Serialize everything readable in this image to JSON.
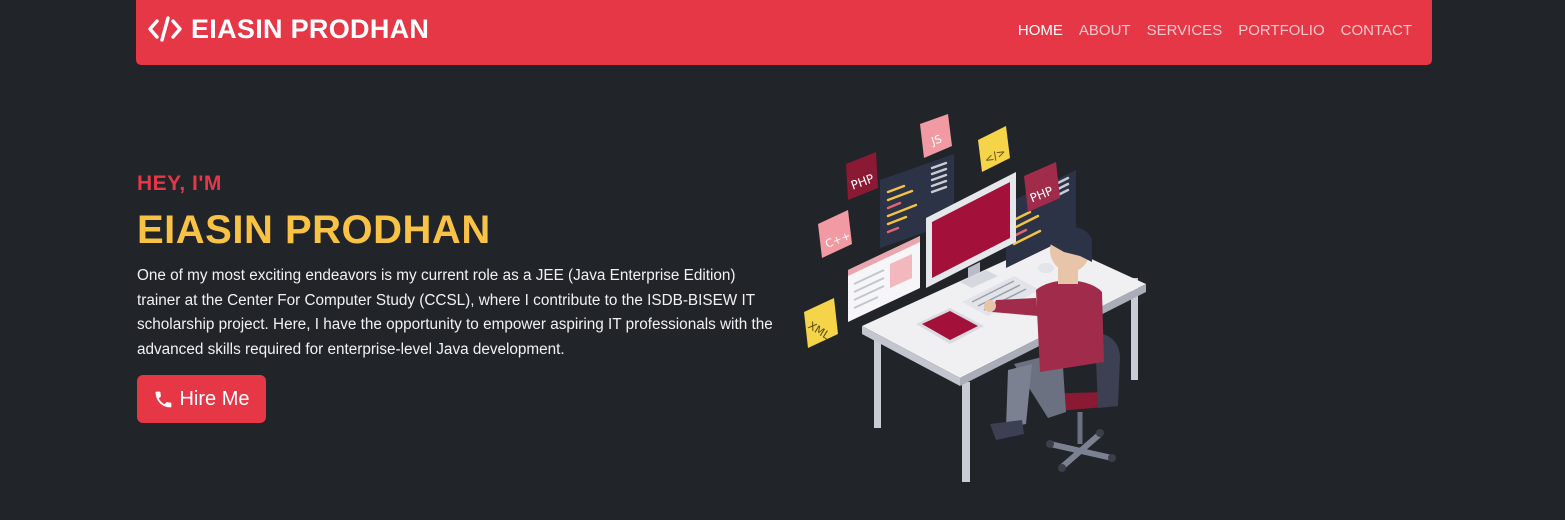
{
  "navbar": {
    "brand_icon": "code-icon",
    "brand": "EIASIN PRODHAN",
    "links": [
      {
        "label": "HOME",
        "active": true
      },
      {
        "label": "ABOUT",
        "active": false
      },
      {
        "label": "SERVICES",
        "active": false
      },
      {
        "label": "PORTFOLIO",
        "active": false
      },
      {
        "label": "CONTACT",
        "active": false
      }
    ]
  },
  "hero": {
    "greeting": "HEY, I'M",
    "name": "EIASIN PRODHAN",
    "description": "One of my most exciting endeavors is my current role as a JEE (Java Enterprise Edition) trainer at the Center For Computer Study (CCSL), where I contribute to the ISDB-BISEW IT scholarship project. Here, I have the opportunity to empower aspiring IT professionals with the advanced skills required for enterprise-level Java development.",
    "hire_button": {
      "label": "Hire Me",
      "icon": "phone-icon"
    }
  },
  "illustration": {
    "badges": [
      "JS",
      "</>",
      "PHP",
      "PHP",
      "C++",
      "XML"
    ]
  },
  "colors": {
    "background": "#212429",
    "accent": "#e63746",
    "name": "#f8c244",
    "text": "#f2f2f2"
  }
}
